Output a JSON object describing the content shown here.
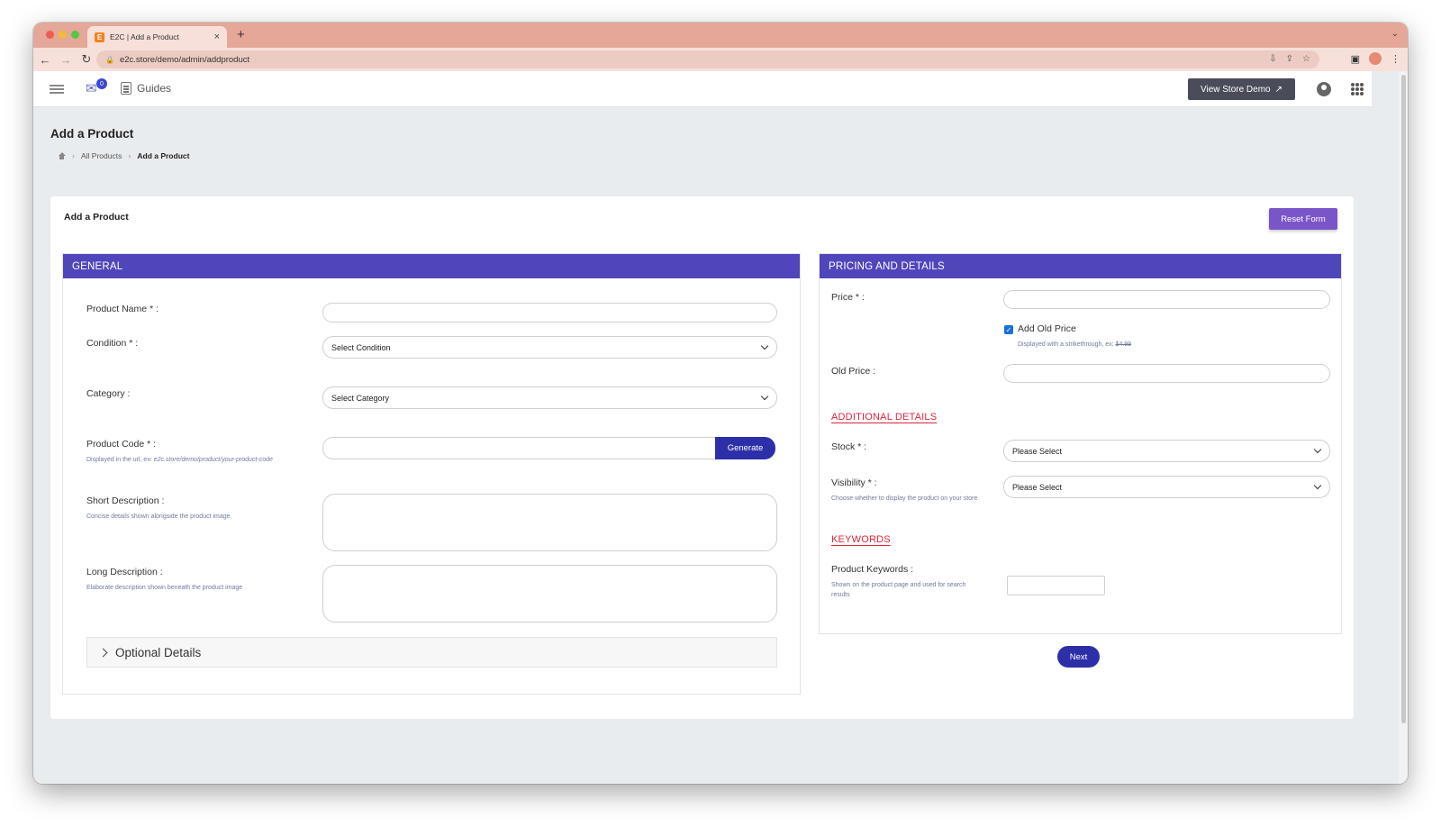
{
  "browser": {
    "tab_title": "E2C | Add a Product",
    "favicon_letter": "E",
    "tab_close": "×",
    "new_tab": "+",
    "url": "e2c.store/demo/admin/addproduct"
  },
  "header": {
    "notification_count": "0",
    "guides_label": "Guides",
    "view_store_label": "View Store Demo",
    "view_store_icon": "↗"
  },
  "page": {
    "title": "Add a Product",
    "breadcrumb": [
      "All Products",
      "Add a Product"
    ]
  },
  "card": {
    "title": "Add a Product",
    "reset_label": "Reset Form"
  },
  "general": {
    "heading": "GENERAL",
    "product_name_label": "Product Name * :",
    "condition_label": "Condition * :",
    "condition_value": "Select Condition",
    "category_label": "Category :",
    "category_value": "Select Category",
    "product_code_label": "Product Code * :",
    "product_code_help_prefix": "Displayed in the url, ex: ",
    "product_code_help_example": "e2c.store/demo/product/your-product-code",
    "generate_label": "Generate",
    "short_desc_label": "Short Description :",
    "short_desc_help": "Concise details shown alongside the product image",
    "long_desc_label": "Long Description :",
    "long_desc_help": "Elaborate description shown beneath the product image",
    "optional_details_label": "Optional Details"
  },
  "pricing": {
    "heading": "PRICING AND DETAILS",
    "price_label": "Price * :",
    "add_old_price_label": "Add Old Price",
    "add_old_price_checked": true,
    "old_price_help_prefix": "Displayed with a strikethrough, ex: ",
    "old_price_help_example": "$4.99",
    "old_price_label": "Old Price :",
    "additional_details_title": "ADDITIONAL DETAILS",
    "stock_label": "Stock * :",
    "stock_value": "Please Select",
    "visibility_label": "Visibility * :",
    "visibility_help": "Choose whether to display the product on your store",
    "visibility_value": "Please Select",
    "keywords_title": "KEYWORDS",
    "keywords_label": "Product Keywords :",
    "keywords_help": "Shown on the product page and used for search results",
    "next_label": "Next"
  },
  "colors": {
    "panel_header": "#5046bb",
    "primary_button": "#2d2fa8",
    "reset_button": "#7a55c9",
    "section_title": "#e0243b",
    "view_store_button": "#4a4c59",
    "browser_tabstrip": "#e4a798"
  }
}
